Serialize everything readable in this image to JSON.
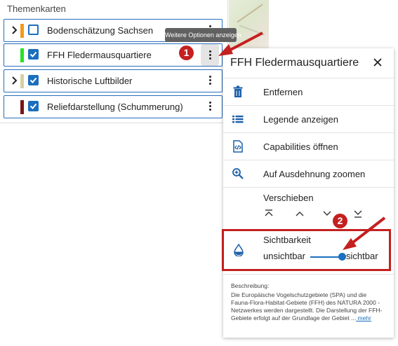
{
  "panel": {
    "title": "Themenkarten",
    "layers": [
      {
        "label": "Bodenschätzung Sachsen",
        "checked": false,
        "has_children": true,
        "color": "#f29a19"
      },
      {
        "label": "FFH Fledermausquartiere",
        "checked": true,
        "has_children": false,
        "color": "#28e228"
      },
      {
        "label": "Historische Luftbilder",
        "checked": true,
        "has_children": true,
        "color": "#d8d0a5"
      },
      {
        "label": "Reliefdarstellung (Schummerung)",
        "checked": true,
        "has_children": false,
        "color": "#7a1515"
      }
    ]
  },
  "tooltip": "Weitere Optionen anzeigen",
  "menu": {
    "title": "FFH Fledermausquartiere",
    "items": [
      {
        "label": "Entfernen",
        "icon": "trash-icon"
      },
      {
        "label": "Legende anzeigen",
        "icon": "list-icon"
      },
      {
        "label": "Capabilities öffnen",
        "icon": "code-file-icon"
      },
      {
        "label": "Auf Ausdehnung zoomen",
        "icon": "zoom-in-icon"
      }
    ],
    "move": {
      "title": "Verschieben",
      "buttons": [
        "move-top-icon",
        "move-up-icon",
        "move-down-icon",
        "move-bottom-icon"
      ]
    },
    "visibility": {
      "title": "Sichtbarkeit",
      "min_label": "unsichtbar",
      "max_label": "sichtbar",
      "value": 1.0
    },
    "description": {
      "heading": "Beschreibung:",
      "text": "Die Europäische Vogelschutzgebiete (SPA) und die Fauna-Flora-Habitat-Gebiete (FFH) des NATURA 2000 - Netzwerkes werden dargestellt. Die Darstellung der FFH-Gebiete erfolgt auf der Grundlage der Gebiet ...",
      "more_link": " mehr"
    }
  },
  "annotations": {
    "badge1": "1",
    "badge2": "2",
    "color": "#c4201f"
  },
  "colors": {
    "accent": "#1b6fbe",
    "border": "#2a6ebb"
  }
}
